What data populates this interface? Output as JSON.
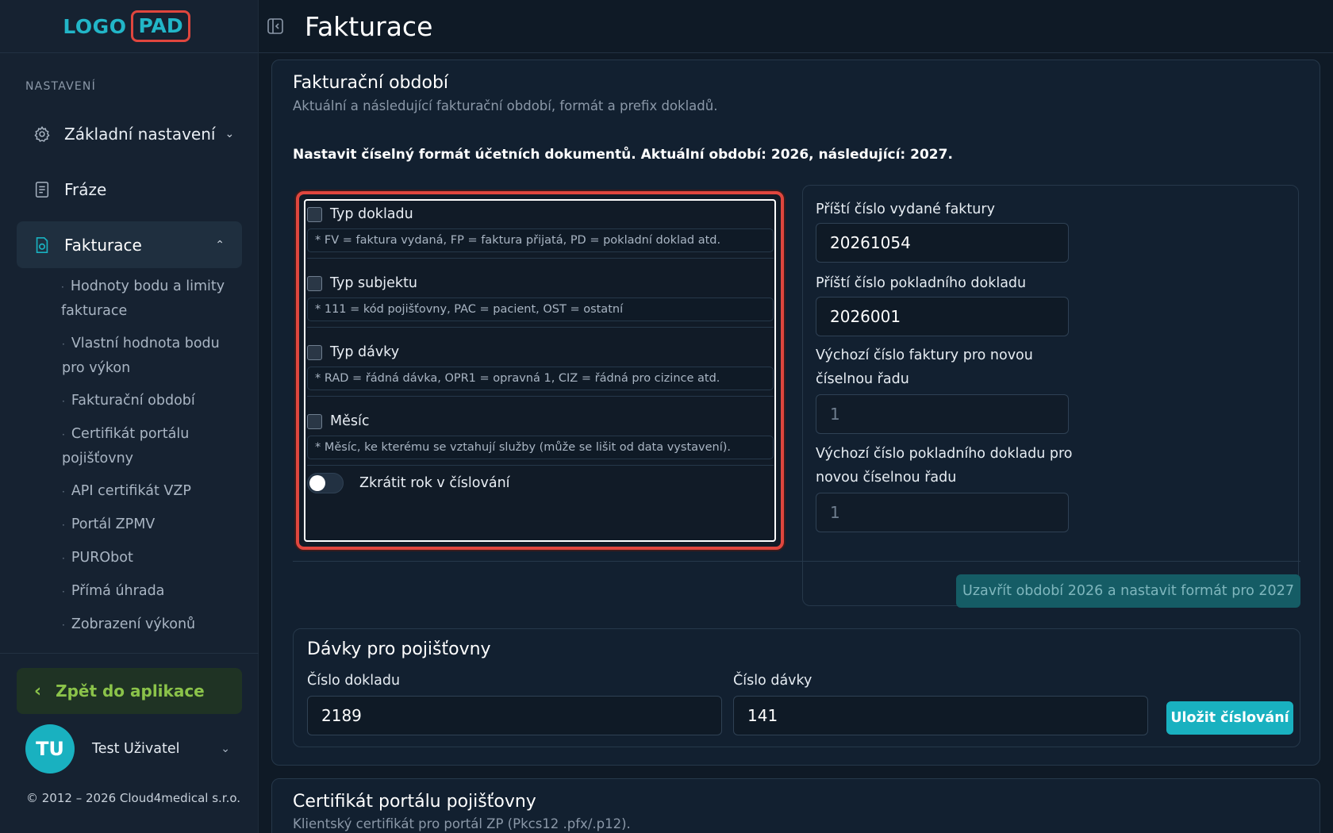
{
  "brand": {
    "logo_left": "LOGO",
    "logo_right": "PAD"
  },
  "header": {
    "title": "Fakturace"
  },
  "sidebar": {
    "section": "NASTAVENÍ",
    "items": [
      {
        "label": "Základní nastavení",
        "icon": "gear-icon"
      },
      {
        "label": "Fráze",
        "icon": "document-icon"
      },
      {
        "label": "Fakturace",
        "icon": "invoice-icon"
      }
    ],
    "subitems": [
      "Hodnoty bodu a limity fakturace",
      "Vlastní hodnota bodu pro výkon",
      "Fakturační období",
      "Certifikát portálu pojišťovny",
      "API certifikát VZP",
      "Portál ZPMV",
      "PURObot",
      "Přímá úhrada",
      "Zobrazení výkonů"
    ],
    "back": "Zpět do aplikace",
    "user_initials": "TU",
    "user_name": "Test Uživatel",
    "copyright": "© 2012 – 2026 Cloud4medical s.r.o."
  },
  "period": {
    "title": "Fakturační období",
    "subtitle": "Aktuální a následující fakturační období, formát a prefix dokladů.",
    "description": "Nastavit číselný formát účetních dokumentů. Aktuální období: 2026, následující: 2027.",
    "options": [
      {
        "label": "Typ dokladu",
        "hint": "* FV = faktura vydaná, FP = faktura přijatá, PD = pokladní doklad atd."
      },
      {
        "label": "Typ subjektu",
        "hint": "* 111 = kód pojišťovny, PAC = pacient, OST = ostatní"
      },
      {
        "label": "Typ dávky",
        "hint": "* RAD = řádná dávka, OPR1 = opravná 1, CIZ = řádná pro cizince atd."
      },
      {
        "label": "Měsíc",
        "hint": "* Měsíc, ke kterému se vztahují služby (může se lišit od data vystavení)."
      }
    ],
    "toggle_label": "Zkrátit rok v číslování",
    "fields": [
      {
        "label": "Příští číslo vydané faktury",
        "value": "20261054"
      },
      {
        "label": "Příští číslo pokladního dokladu",
        "value": "2026001"
      },
      {
        "label": "Výchozí číslo faktury pro novou číselnou řadu",
        "value": "1"
      },
      {
        "label": "Výchozí číslo pokladního dokladu pro novou číselnou řadu",
        "value": "1"
      }
    ],
    "close_button": "Uzavřít období 2026 a nastavit formát pro 2027"
  },
  "batches": {
    "title": "Dávky pro pojišťovny",
    "doc_label": "Číslo dokladu",
    "doc_value": "2189",
    "batch_label": "Číslo dávky",
    "batch_value": "141",
    "save_button": "Uložit číslování"
  },
  "certificate": {
    "title": "Certifikát portálu pojišťovny",
    "subtitle": "Klientský certifikát pro portál ZP (Pkcs12 .pfx/.p12)."
  }
}
